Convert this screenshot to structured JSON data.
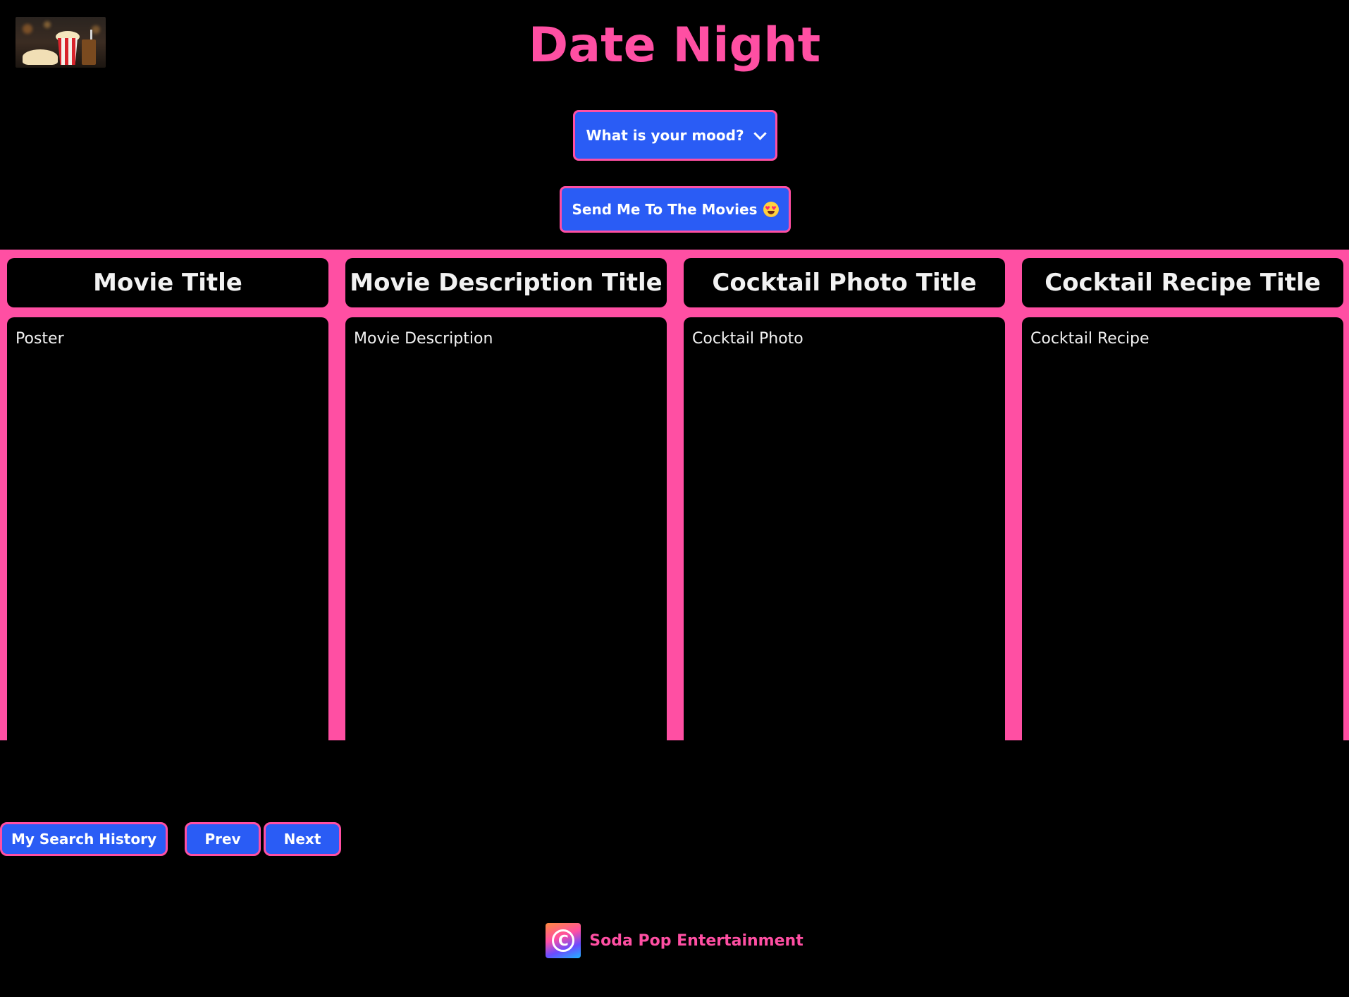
{
  "header": {
    "title": "Date Night",
    "logo_icon": "popcorn-movie-logo"
  },
  "controls": {
    "mood_label": "What is your mood?",
    "send_label": "Send Me To The Movies",
    "send_emoji": "star-struck-emoji"
  },
  "columns": [
    {
      "heading": "Movie Title",
      "body": "Poster"
    },
    {
      "heading": "Movie Description Title",
      "body": "Movie Description"
    },
    {
      "heading": "Cocktail Photo Title",
      "body": "Cocktail Photo"
    },
    {
      "heading": "Cocktail Recipe Title",
      "body": "Cocktail Recipe"
    }
  ],
  "history": {
    "history_label": "My Search History",
    "prev_label": "Prev",
    "next_label": "Next"
  },
  "footer": {
    "text": "Soda Pop Entertainment",
    "icon": "copyright-icon"
  },
  "colors": {
    "accent_pink": "#ff4fa3",
    "button_blue": "#2a5cf5",
    "background": "#000000"
  }
}
